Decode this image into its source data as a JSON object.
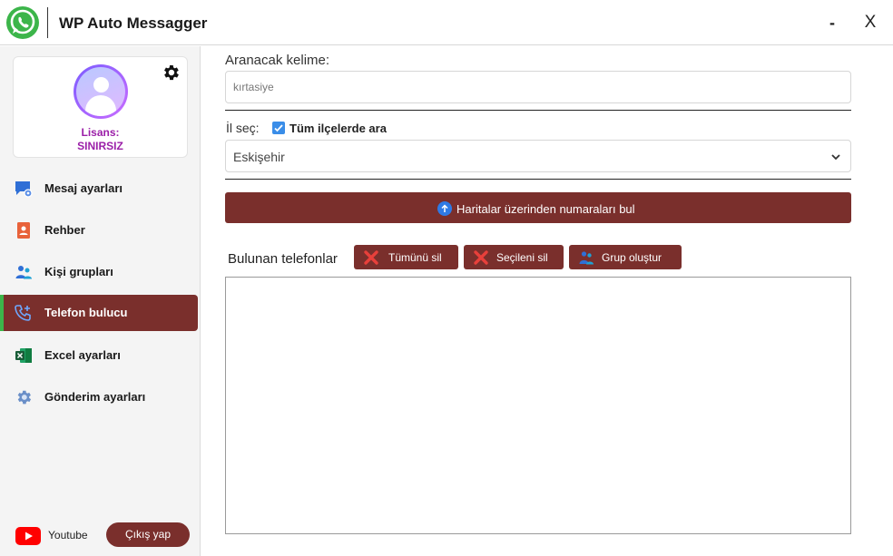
{
  "window": {
    "title": "WP Auto Messagger",
    "minimize_label": "-",
    "close_label": "X"
  },
  "profile": {
    "license_label": "Lisans:",
    "license_value": "SINIRSIZ"
  },
  "sidebar": {
    "items": [
      {
        "label": "Mesaj ayarları",
        "icon": "message-settings-icon"
      },
      {
        "label": "Rehber",
        "icon": "contacts-book-icon"
      },
      {
        "label": "Kişi grupları",
        "icon": "people-group-icon"
      },
      {
        "label": "Telefon bulucu",
        "icon": "phone-add-icon",
        "active": true
      },
      {
        "label": "Excel ayarları",
        "icon": "excel-icon"
      },
      {
        "label": "Gönderim ayarları",
        "icon": "cog-icon"
      }
    ],
    "youtube_label": "Youtube",
    "logout_label": "Çıkış yap"
  },
  "main": {
    "search_label": "Aranacak kelime:",
    "search_value": "kırtasiye",
    "city_label": "İl seç:",
    "all_districts_label": "Tüm ilçelerde ara",
    "all_districts_checked": true,
    "city_value": "Eskişehir",
    "find_button_label": "Haritalar üzerinden numaraları bul",
    "found_label": "Bulunan telefonlar",
    "delete_all_label": "Tümünü sil",
    "delete_selected_label": "Seçileni sil",
    "create_group_label": "Grup oluştur",
    "results": []
  },
  "colors": {
    "accent": "#7a2f2c",
    "active_indicator": "#3cb54a",
    "license": "#9b1fa8",
    "checkbox": "#3a8de8"
  }
}
